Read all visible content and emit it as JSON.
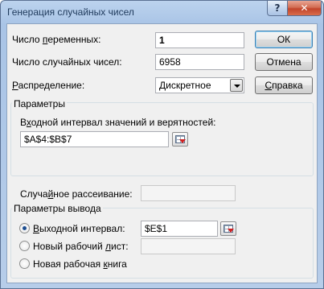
{
  "window": {
    "title": "Генерация случайных чисел",
    "help_glyph": "?",
    "close_glyph": "✕"
  },
  "fields": {
    "num_variables": {
      "label_pre": "Число ",
      "label_u": "п",
      "label_post": "еременных:",
      "value": "1"
    },
    "num_random": {
      "label_pre": "Число случайных чисел:",
      "value": "6958"
    },
    "distribution": {
      "label_pre": "",
      "label_u": "Р",
      "label_post": "аспределение:",
      "value": "Дискретное"
    }
  },
  "buttons": {
    "ok": "ОК",
    "cancel": "Отмена",
    "help_pre": "",
    "help_u": "С",
    "help_post": "правка"
  },
  "params_group": {
    "title": "Параметры",
    "input_label_pre": "В",
    "input_label_u": "х",
    "input_label_post": "одной интервал значений и верятностей:",
    "input_value": "$A$4:$B$7"
  },
  "random_seed": {
    "label_pre": "Случа",
    "label_u": "й",
    "label_post": "ное рассеивание:",
    "value": ""
  },
  "output_group": {
    "title": "Параметры вывода",
    "options": [
      {
        "pre": "",
        "u": "В",
        "post": "ыходной интервал:",
        "value": "$E$1",
        "checked": true
      },
      {
        "pre": "Новый рабочий ",
        "u": "л",
        "post": "ист:",
        "value": "",
        "checked": false
      },
      {
        "pre": "Новая рабочая ",
        "u": "к",
        "post": "нига",
        "checked": false
      }
    ]
  }
}
